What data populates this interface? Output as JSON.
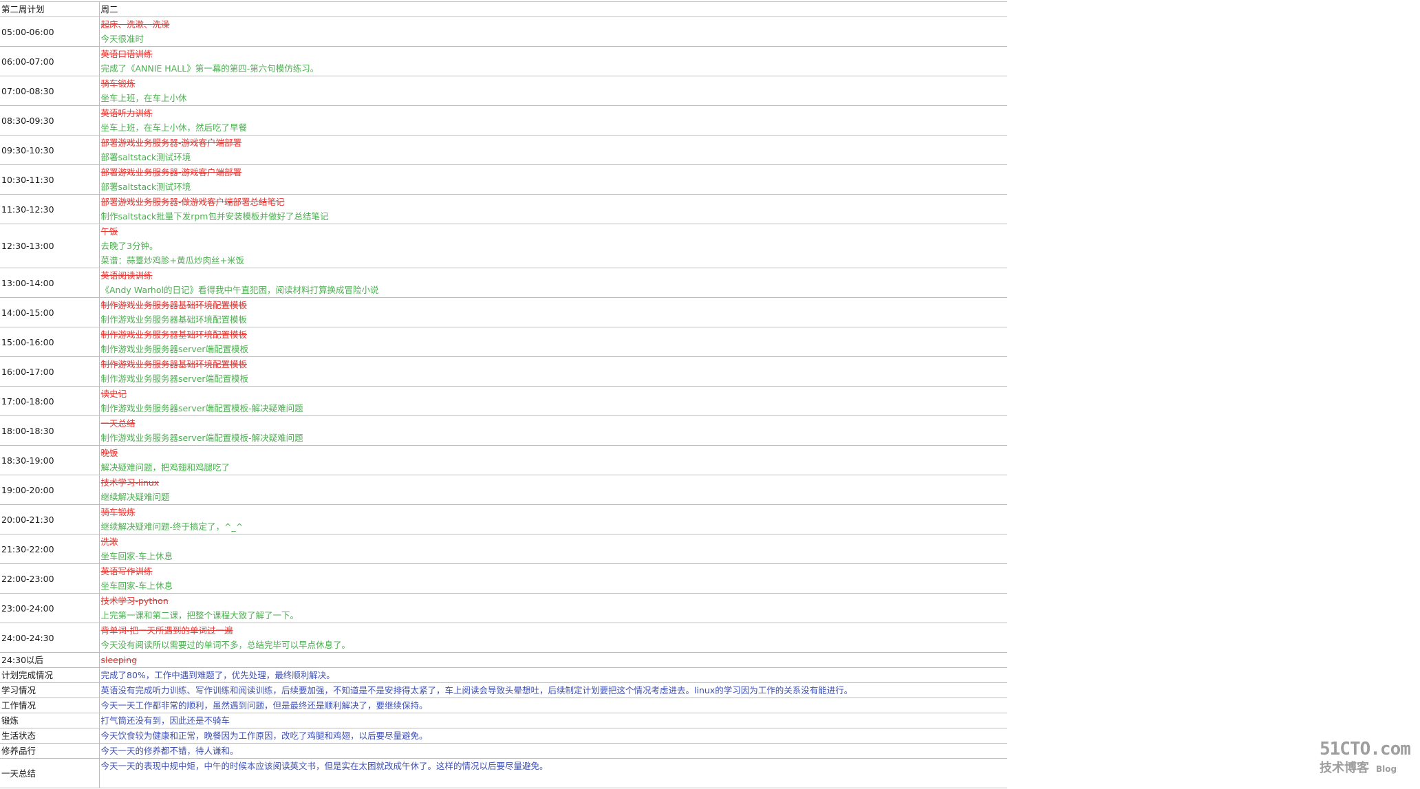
{
  "header": {
    "col1": "第二周计划",
    "col2": "周二"
  },
  "slots": [
    {
      "time": "05:00-06:00",
      "plan": "起床、洗漱、洗澡",
      "done": [
        "今天很准时"
      ]
    },
    {
      "time": "06:00-07:00",
      "plan": "英语口语训练",
      "done": [
        "完成了《ANNIE HALL》第一幕的第四-第六句模仿练习。"
      ]
    },
    {
      "time": "07:00-08:30",
      "plan": "骑车锻炼",
      "done": [
        "坐车上班，在车上小休"
      ]
    },
    {
      "time": "08:30-09:30",
      "plan": "英语听力训练",
      "done": [
        "坐车上班，在车上小休，然后吃了早餐"
      ]
    },
    {
      "time": "09:30-10:30",
      "plan": "部署游戏业务服务器-游戏客户端部署",
      "done": [
        "部署saltstack测试环境"
      ]
    },
    {
      "time": "10:30-11:30",
      "plan": "部署游戏业务服务器-游戏客户端部署",
      "done": [
        "部署saltstack测试环境"
      ]
    },
    {
      "time": "11:30-12:30",
      "plan": "部署游戏业务服务器-做游戏客户端部署总结笔记",
      "done": [
        "制作saltstack批量下发rpm包并安装模板并做好了总结笔记"
      ]
    },
    {
      "time": "12:30-13:00",
      "plan": "午饭",
      "done": [
        "去晚了3分钟。",
        "菜谱：蒜薹炒鸡胗+黄瓜炒肉丝+米饭"
      ]
    },
    {
      "time": "13:00-14:00",
      "plan": "英语阅读训练",
      "done": [
        "《Andy Warhol的日记》看得我中午直犯困，阅读材料打算换成冒险小说"
      ]
    },
    {
      "time": "14:00-15:00",
      "plan": "制作游戏业务服务器基础环境配置模板",
      "done": [
        "制作游戏业务服务器基础环境配置模板"
      ]
    },
    {
      "time": "15:00-16:00",
      "plan": "制作游戏业务服务器基础环境配置模板",
      "done": [
        "制作游戏业务服务器server端配置模板"
      ]
    },
    {
      "time": "16:00-17:00",
      "plan": "制作游戏业务服务器基础环境配置模板",
      "done": [
        "制作游戏业务服务器server端配置模板"
      ]
    },
    {
      "time": "17:00-18:00",
      "plan": "读史记",
      "done": [
        "制作游戏业务服务器server端配置模板-解决疑难问题"
      ]
    },
    {
      "time": "18:00-18:30",
      "plan": "一天总结",
      "done": [
        "制作游戏业务服务器server端配置模板-解决疑难问题"
      ]
    },
    {
      "time": "18:30-19:00",
      "plan": "晚饭",
      "done": [
        "解决疑难问题，把鸡翅和鸡腿吃了"
      ]
    },
    {
      "time": "19:00-20:00",
      "plan": "技术学习-linux",
      "done": [
        "继续解决疑难问题"
      ]
    },
    {
      "time": "20:00-21:30",
      "plan": "骑车锻炼",
      "done": [
        "继续解决疑难问题-终于搞定了，^_^"
      ]
    },
    {
      "time": "21:30-22:00",
      "plan": "洗漱",
      "done": [
        "坐车回家-车上休息"
      ]
    },
    {
      "time": "22:00-23:00",
      "plan": "英语写作训练",
      "done": [
        "坐车回家-车上休息"
      ]
    },
    {
      "time": "23:00-24:00",
      "plan": "技术学习-python",
      "done": [
        "上完第一课和第二课，把整个课程大致了解了一下。"
      ]
    },
    {
      "time": "24:00-24:30",
      "plan": "背单词-把一天所遇到的单词过一遍",
      "done": [
        "今天没有阅读所以需要过的单词不多，总结完毕可以早点休息了。"
      ]
    },
    {
      "time": "24:30以后",
      "plan": "sleeping",
      "done": []
    }
  ],
  "summaries": [
    {
      "label": "计划完成情况",
      "text": "完成了80%，工作中遇到难题了，优先处理，最终顺利解决。"
    },
    {
      "label": "学习情况",
      "text": "英语没有完成听力训练、写作训练和阅读训练，后续要加强，不知道是不是安排得太紧了，车上阅读会导致头晕想吐，后续制定计划要把这个情况考虑进去。linux的学习因为工作的关系没有能进行。"
    },
    {
      "label": "工作情况",
      "text": "今天一天工作都非常的顺利，虽然遇到问题，但是最终还是顺利解决了，要继续保持。"
    },
    {
      "label": "锻炼",
      "text": "打气筒还没有到，因此还是不骑车"
    },
    {
      "label": "生活状态",
      "text": "今天饮食较为健康和正常，晚餐因为工作原因，改吃了鸡腿和鸡翅，以后要尽量避免。"
    },
    {
      "label": "修养品行",
      "text": "今天一天的修养都不错，待人谦和。"
    },
    {
      "label": "一天总结",
      "text": "今天一天的表现中规中矩，中午的时候本应该阅读英文书，但是实在太困就改成午休了。这样的情况以后要尽量避免。"
    }
  ],
  "watermark": {
    "line1": "51CTO.com",
    "line2": "技术博客",
    "line3": "Blog"
  },
  "colors": {
    "plan": "#e53935",
    "done": "#4caf50",
    "summary": "#3f51b5",
    "grid": "#bdbdbd"
  }
}
